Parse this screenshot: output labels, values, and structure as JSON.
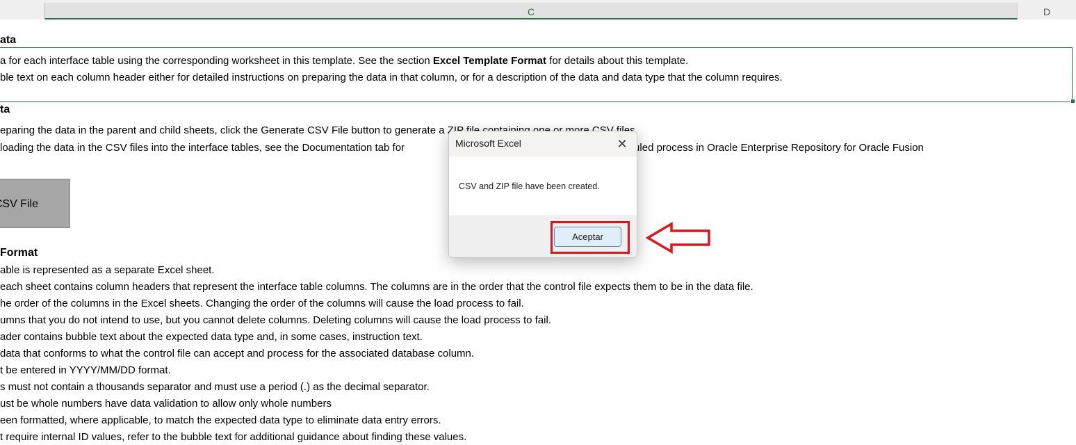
{
  "column_headers": {
    "c": "C",
    "d": "D"
  },
  "lines": {
    "heading1": "ata",
    "l1_pre": "a for each interface table using the corresponding worksheet in this template. See the section ",
    "l1_bold": "Excel Template Format",
    "l1_post": " for details about this template.",
    "l2": "ble text on each column header either for detailed instructions on preparing the data in that column, or for a description of the data and data type that the column requires.",
    "heading2": "ta",
    "l3": "eparing the data in the parent and child sheets, click the Generate CSV File button to generate a ZIP file containing one or more CSV files.",
    "l4_pre": "loading the data in the CSV files into the interface tables, see the Documentation tab for",
    "l4_post": "heduled process in Oracle Enterprise Repository for Oracle Fusion",
    "heading3": "Format",
    "l5": "able is represented as a separate Excel sheet.",
    "l6": "each sheet contains column headers that represent the interface table columns. The columns are in the order that the control file expects them to be in the data file.",
    "l7": "he order of the columns in the Excel sheets. Changing the order of the columns will cause the load process to fail.",
    "l8": "umns that you do not intend to use, but you cannot delete columns. Deleting columns will cause the load process to fail.",
    "l9": "ader contains bubble text about the expected data type and, in some cases, instruction text.",
    "l10": "data that conforms to what the control file can accept and process for the associated database column.",
    "l11": "t be entered in YYYY/MM/DD format.",
    "l12": "s must not contain a thousands separator and must use a period (.) as the decimal separator.",
    "l13": "ust be whole numbers have data validation to allow only whole numbers",
    "l14": "een formatted, where applicable, to match the expected data type to eliminate data entry errors.",
    "l15": "t require internal ID values, refer to the bubble text for additional guidance about finding these values."
  },
  "csv_button": {
    "label": "CSV File"
  },
  "dialog": {
    "title": "Microsoft Excel",
    "close_glyph": "✕",
    "message": "CSV and ZIP file have been created.",
    "ok_label": "Aceptar"
  },
  "colors": {
    "accent_green": "#217346",
    "highlight_red": "#e3131b",
    "ok_border": "#4d8fd6"
  },
  "icons": {
    "close": "close-icon",
    "arrow": "left-arrow-outline-icon"
  }
}
